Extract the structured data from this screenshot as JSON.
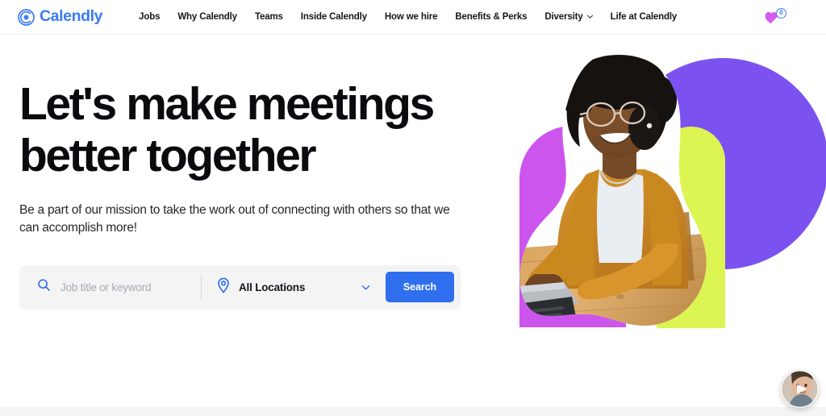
{
  "brand": {
    "name": "Calendly",
    "logo_icon": "calendly-circle-logo",
    "brand_blue": "#3a7bf5",
    "accent_blue": "#2f6fed"
  },
  "nav": {
    "items": [
      {
        "label": "Jobs",
        "has_dropdown": false
      },
      {
        "label": "Why Calendly",
        "has_dropdown": false
      },
      {
        "label": "Teams",
        "has_dropdown": false
      },
      {
        "label": "Inside Calendly",
        "has_dropdown": false
      },
      {
        "label": "How we hire",
        "has_dropdown": false
      },
      {
        "label": "Benefits & Perks",
        "has_dropdown": false
      },
      {
        "label": "Diversity",
        "has_dropdown": true
      },
      {
        "label": "Life at Calendly",
        "has_dropdown": false
      }
    ],
    "saved_jobs": {
      "icon": "heart-icon",
      "count": "0",
      "heart_color": "#d65bf0"
    }
  },
  "hero": {
    "headline": "Let's make meetings better together",
    "subhead": "Be a part of our mission to take the work out of connecting with others so that we can accomplish more!",
    "search": {
      "keyword_placeholder": "Job title or keyword",
      "keyword_value": "",
      "keyword_icon": "search-icon",
      "location_icon": "map-pin-icon",
      "location_value": "All Locations",
      "location_chevron": "chevron-down-icon",
      "search_button_label": "Search"
    },
    "artwork": {
      "alt": "Woman with glasses smiling while typing on a laptop at a wooden desk",
      "shape_purple": "#7b52f0",
      "shape_magenta": "#cc55ee",
      "shape_lime": "#dcf552"
    }
  },
  "video_widget": {
    "icon": "play-icon",
    "alt": "Video greeting thumbnail"
  }
}
